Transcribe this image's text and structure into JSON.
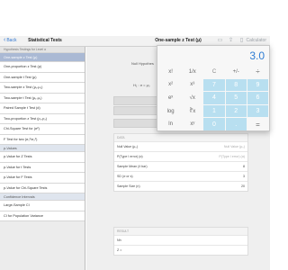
{
  "topbar": {
    "back_label": "Back",
    "left_title": "Statistical Tests",
    "main_title": "One-sample z Test (μ)",
    "calculator_label": "Calculator"
  },
  "sidebar": {
    "items": [
      {
        "label": "Hypothesis Testings for Level α",
        "kind": "header"
      },
      {
        "label": "One-sample z Test (μ)",
        "kind": "selected"
      },
      {
        "label": "One-proportion z Test (p)",
        "kind": "item"
      },
      {
        "label": "One-sample t Test (μ)",
        "kind": "item"
      },
      {
        "label": "Two-sample z Test (μ₁-μ₂)",
        "kind": "item"
      },
      {
        "label": "Two-sample t Test (μ₁-μ₂)",
        "kind": "item"
      },
      {
        "label": "Paired Sample t Test (d)",
        "kind": "item"
      },
      {
        "label": "Two-proportion z Test (p₁-p₂)",
        "kind": "item"
      },
      {
        "label": "Chi-Square Test for (σ²)",
        "kind": "item"
      },
      {
        "label": "F Test for two (σ₁²/σ₂²)",
        "kind": "item"
      },
      {
        "label": "p-Values",
        "kind": "sub"
      },
      {
        "label": "p-Value for Z Tests",
        "kind": "item"
      },
      {
        "label": "p-Value for t Tests",
        "kind": "item"
      },
      {
        "label": "p-Value for F Tests",
        "kind": "item"
      },
      {
        "label": "p-Value for Chi-Square Tests",
        "kind": "item"
      },
      {
        "label": "Confidence Intervals",
        "kind": "sub"
      },
      {
        "label": "Large-Sample CI",
        "kind": "item"
      },
      {
        "label": "CI for Population Variance",
        "kind": "item"
      }
    ]
  },
  "main": {
    "null_hypothesis_label": "Null Hypothes",
    "h1_label": "H₁ : σ = μ₀",
    "data_section": {
      "head": "DATA",
      "rows": [
        {
          "label": "Null Value (μ₀)",
          "value": "Null Value (μ₀)"
        },
        {
          "label": "P(Type I error) (α)",
          "value": "P(Type I error) (α)"
        },
        {
          "label": "Sample Mean (x̄ bar)",
          "value": "8"
        },
        {
          "label": "SD (σ or s)",
          "value": "3"
        },
        {
          "label": "Sample Size (n)",
          "value": "20"
        }
      ]
    },
    "result_section": {
      "head": "RESULT",
      "rows": [
        {
          "label": "Nh",
          "value": ""
        },
        {
          "label": "Z =",
          "value": ""
        }
      ]
    }
  },
  "calculator": {
    "display": "3.0",
    "keys": [
      {
        "label": "x!",
        "kind": "fn"
      },
      {
        "label": "1/x",
        "kind": "fn"
      },
      {
        "label": "C",
        "kind": "clear"
      },
      {
        "label": "+/-",
        "kind": "fn"
      },
      {
        "label": "÷",
        "kind": "op"
      },
      {
        "label": "x²",
        "kind": "fn"
      },
      {
        "label": "x³",
        "kind": "fn"
      },
      {
        "label": "7",
        "kind": "num"
      },
      {
        "label": "8",
        "kind": "num"
      },
      {
        "label": "9",
        "kind": "num"
      },
      {
        "label": "eˣ",
        "kind": "fn"
      },
      {
        "label": "√x",
        "kind": "fn"
      },
      {
        "label": "4",
        "kind": "num"
      },
      {
        "label": "5",
        "kind": "num"
      },
      {
        "label": "6",
        "kind": "num"
      },
      {
        "label": "log",
        "kind": "fn"
      },
      {
        "label": "∛x",
        "kind": "fn"
      },
      {
        "label": "1",
        "kind": "num"
      },
      {
        "label": "2",
        "kind": "num"
      },
      {
        "label": "3",
        "kind": "num"
      },
      {
        "label": "ln",
        "kind": "fn"
      },
      {
        "label": "xʸ",
        "kind": "fn"
      },
      {
        "label": "0",
        "kind": "num"
      },
      {
        "label": ".",
        "kind": "num"
      },
      {
        "label": "=",
        "kind": "op"
      }
    ],
    "side_ops": [
      "×",
      "−",
      "+"
    ]
  }
}
